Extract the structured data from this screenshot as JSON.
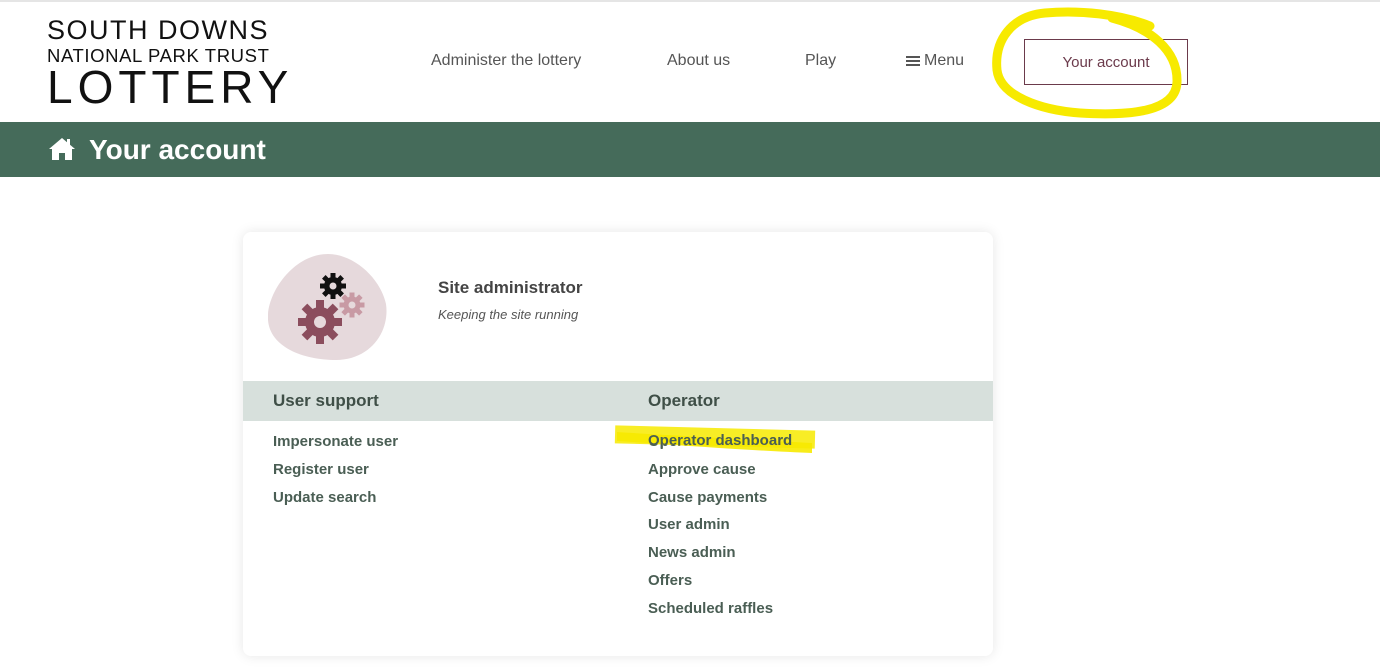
{
  "logo": {
    "line1": "SOUTH DOWNS",
    "line2": "NATIONAL PARK TRUST",
    "line3": "LOTTERY"
  },
  "nav": {
    "administer": "Administer the lottery",
    "about": "About us",
    "play": "Play",
    "menu": "Menu",
    "account": "Your account"
  },
  "banner": {
    "title": "Your account"
  },
  "card": {
    "role_title": "Site administrator",
    "role_subtitle": "Keeping the site running",
    "user_support": {
      "heading": "User support",
      "links": [
        "Impersonate user",
        "Register user",
        "Update search"
      ]
    },
    "operator": {
      "heading": "Operator",
      "links": [
        "Operator dashboard",
        "Approve cause",
        "Cause payments",
        "User admin",
        "News admin",
        "Offers",
        "Scheduled raffles"
      ]
    }
  },
  "colors": {
    "banner": "#456b5a",
    "accent": "#6b3a4b",
    "section_bar": "#d7e0dc",
    "highlight": "#f7ea00"
  },
  "icons": {
    "home": "home-icon",
    "menu": "hamburger-icon",
    "avatar": "gears-icon"
  }
}
